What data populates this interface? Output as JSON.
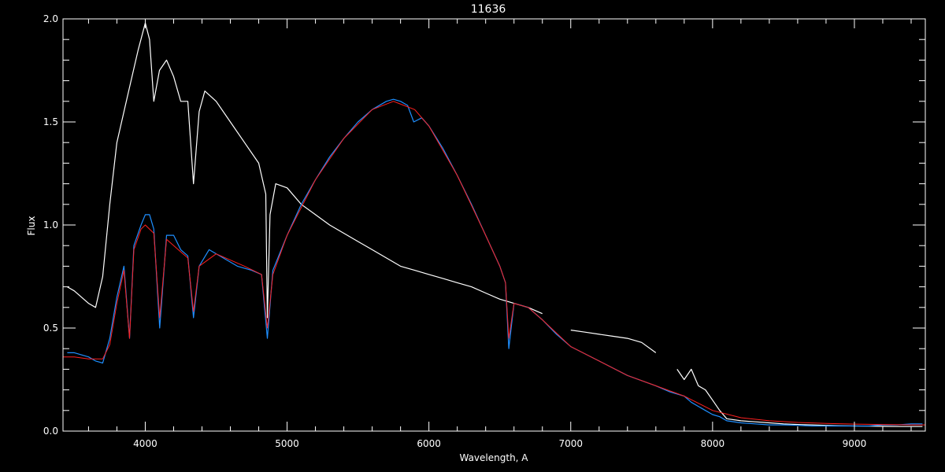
{
  "chart_data": {
    "type": "line",
    "title": "11636",
    "xlabel": "Wavelength, A",
    "ylabel": "Flux",
    "xlim": [
      3420,
      9500
    ],
    "ylim": [
      0,
      2.0
    ],
    "x_ticks": [
      4000,
      5000,
      6000,
      7000,
      8000,
      9000
    ],
    "x_tick_labels": [
      "4000",
      "5000",
      "6000",
      "7000",
      "8000",
      "9000"
    ],
    "y_ticks": [
      0.0,
      0.5,
      1.0,
      1.5,
      2.0
    ],
    "y_tick_labels": [
      "0.0",
      "0.5",
      "1.0",
      "1.5",
      "2.0"
    ],
    "grid": false,
    "legend": "none",
    "colors": {
      "background": "#000000",
      "axes": "#ffffff",
      "white_series": "#ffffff",
      "blue_series": "#1f8fff",
      "red_series": "#ff2020"
    },
    "series": [
      {
        "color": "#ffffff",
        "x": [
          3450,
          3500,
          3550,
          3600,
          3650,
          3700,
          3750,
          3800,
          3850,
          3900,
          3950,
          4000,
          4030,
          4060,
          4100,
          4150,
          4200,
          4250,
          4300,
          4340,
          4380,
          4420,
          4500,
          4600,
          4700,
          4800,
          4850,
          4861,
          4880,
          4920,
          5000,
          5100,
          5200,
          5300,
          5400,
          5500,
          5600,
          5700,
          5800,
          5900,
          6000,
          6100,
          6200,
          6300,
          6400,
          6500,
          6600,
          6700,
          6800,
          6950,
          7000,
          7100,
          7200,
          7300,
          7400,
          7500,
          7600,
          7700,
          7750,
          7800,
          7850,
          7900,
          7950,
          8000,
          8050,
          8100,
          8200,
          8300,
          8400,
          8500,
          8600,
          8700,
          8800,
          8900,
          9000,
          9100,
          9200,
          9300,
          9400,
          9480
        ],
        "y": [
          0.7,
          0.68,
          0.65,
          0.62,
          0.6,
          0.75,
          1.1,
          1.4,
          1.55,
          1.7,
          1.85,
          1.98,
          1.9,
          1.6,
          1.75,
          1.8,
          1.72,
          1.6,
          1.6,
          1.2,
          1.55,
          1.65,
          1.6,
          1.5,
          1.4,
          1.3,
          1.15,
          0.55,
          1.05,
          1.2,
          1.18,
          1.1,
          1.05,
          1.0,
          0.96,
          0.92,
          0.88,
          0.84,
          0.8,
          0.78,
          0.76,
          0.74,
          0.72,
          0.7,
          0.67,
          0.64,
          0.62,
          0.6,
          0.57,
          null,
          0.49,
          0.48,
          0.47,
          0.46,
          0.45,
          0.43,
          0.38,
          null,
          0.3,
          0.25,
          0.3,
          0.22,
          0.2,
          0.15,
          0.1,
          0.06,
          0.05,
          0.045,
          0.04,
          0.035,
          0.032,
          0.03,
          0.028,
          0.026,
          0.025,
          0.024,
          0.023,
          0.022,
          0.022,
          0.022
        ]
      },
      {
        "color": "#1f8fff",
        "x": [
          3450,
          3500,
          3550,
          3600,
          3650,
          3700,
          3750,
          3800,
          3850,
          3889,
          3920,
          3970,
          4000,
          4030,
          4060,
          4102,
          4150,
          4200,
          4250,
          4300,
          4340,
          4380,
          4450,
          4550,
          4650,
          4750,
          4820,
          4861,
          4900,
          5000,
          5100,
          5200,
          5300,
          5400,
          5500,
          5600,
          5700,
          5750,
          5800,
          5850,
          5893,
          5950,
          6000,
          6100,
          6200,
          6300,
          6400,
          6500,
          6540,
          6563,
          6600,
          6700,
          6800,
          6900,
          7000,
          7200,
          7400,
          7600,
          7700,
          7800,
          7850,
          7900,
          7950,
          8000,
          8050,
          8100,
          8200,
          8300,
          8400,
          8500,
          8600,
          8700,
          8800,
          8900,
          9000,
          9100,
          9200,
          9300,
          9400,
          9480
        ],
        "y": [
          0.38,
          0.38,
          0.37,
          0.36,
          0.34,
          0.33,
          0.45,
          0.65,
          0.8,
          0.45,
          0.9,
          1.0,
          1.05,
          1.05,
          0.98,
          0.5,
          0.95,
          0.95,
          0.88,
          0.85,
          0.55,
          0.8,
          0.88,
          0.84,
          0.8,
          0.78,
          0.76,
          0.45,
          0.78,
          0.95,
          1.1,
          1.22,
          1.33,
          1.42,
          1.5,
          1.56,
          1.6,
          1.61,
          1.6,
          1.58,
          1.5,
          1.52,
          1.48,
          1.37,
          1.24,
          1.1,
          0.95,
          0.8,
          0.72,
          0.4,
          0.62,
          0.6,
          0.54,
          0.47,
          0.41,
          0.34,
          0.27,
          0.22,
          0.19,
          0.17,
          0.14,
          0.12,
          0.1,
          0.08,
          0.07,
          0.05,
          0.04,
          0.035,
          0.03,
          0.03,
          0.028,
          0.025,
          0.025,
          0.025,
          0.025,
          0.025,
          0.03,
          0.03,
          0.035,
          0.035
        ]
      },
      {
        "color": "#ff2020",
        "x": [
          3420,
          3500,
          3600,
          3700,
          3750,
          3800,
          3850,
          3889,
          3920,
          3970,
          4000,
          4060,
          4102,
          4150,
          4250,
          4300,
          4340,
          4380,
          4500,
          4700,
          4820,
          4861,
          4900,
          5000,
          5200,
          5400,
          5600,
          5750,
          5900,
          6000,
          6200,
          6400,
          6500,
          6540,
          6563,
          6600,
          6700,
          6800,
          7000,
          7200,
          7400,
          7600,
          7800,
          8000,
          8200,
          8400,
          8600,
          8800,
          9000,
          9200,
          9400,
          9500
        ],
        "y": [
          0.36,
          0.36,
          0.35,
          0.35,
          0.42,
          0.62,
          0.78,
          0.45,
          0.88,
          0.98,
          1.0,
          0.96,
          0.55,
          0.93,
          0.87,
          0.84,
          0.58,
          0.8,
          0.86,
          0.8,
          0.76,
          0.5,
          0.76,
          0.95,
          1.22,
          1.42,
          1.56,
          1.6,
          1.56,
          1.48,
          1.24,
          0.95,
          0.8,
          0.72,
          0.45,
          0.62,
          0.6,
          0.54,
          0.41,
          0.34,
          0.27,
          0.22,
          0.17,
          0.1,
          0.065,
          0.05,
          0.042,
          0.037,
          0.034,
          0.032,
          0.03,
          0.03
        ]
      }
    ]
  }
}
